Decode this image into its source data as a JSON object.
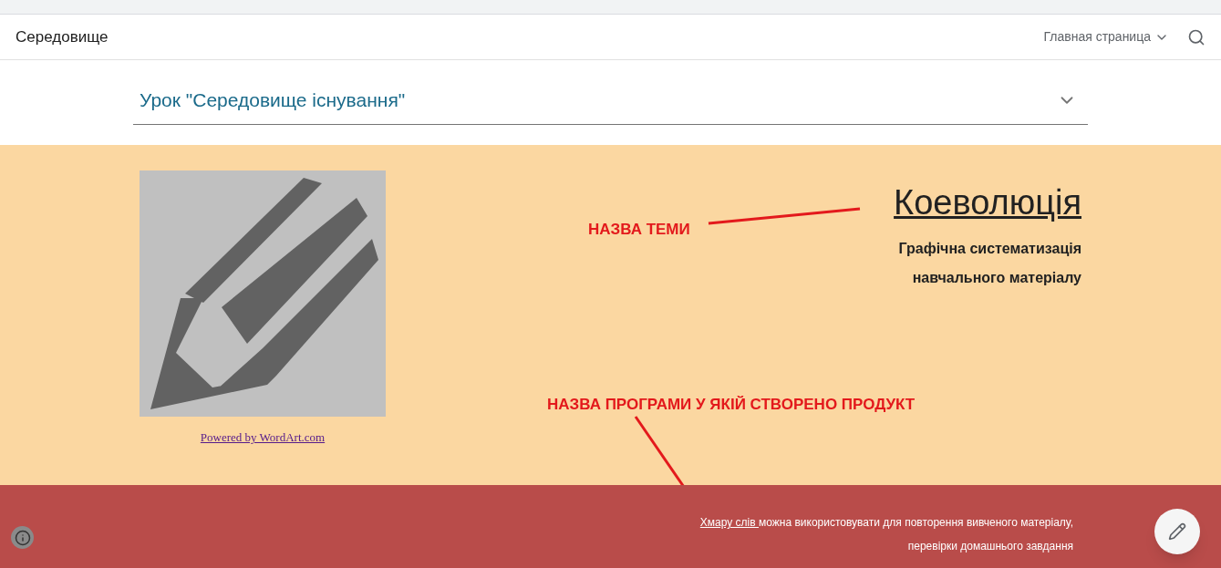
{
  "header": {
    "site_title": "Середовище",
    "nav_label": "Главная страница"
  },
  "accordion": {
    "title": "Урок \"Середовище існування\"",
    "expanded": false
  },
  "content": {
    "image_caption": "Powered by WordArt.com",
    "heading": "Коеволюція",
    "subtitle_lines": [
      "Графічна систематизація",
      "навчального матеріалу"
    ],
    "annotations": [
      {
        "text": "НАЗВА ТЕМИ"
      },
      {
        "text": "НАЗВА ПРОГРАМИ У ЯКІЙ СТВОРЕНО ПРОДУКТ"
      }
    ]
  },
  "footer": {
    "link": "Хмару слів ",
    "text_line_1": "можна використовувати для повторення вивченого матеріалу,",
    "text_line_2": "перевірки домашнього завдання"
  }
}
